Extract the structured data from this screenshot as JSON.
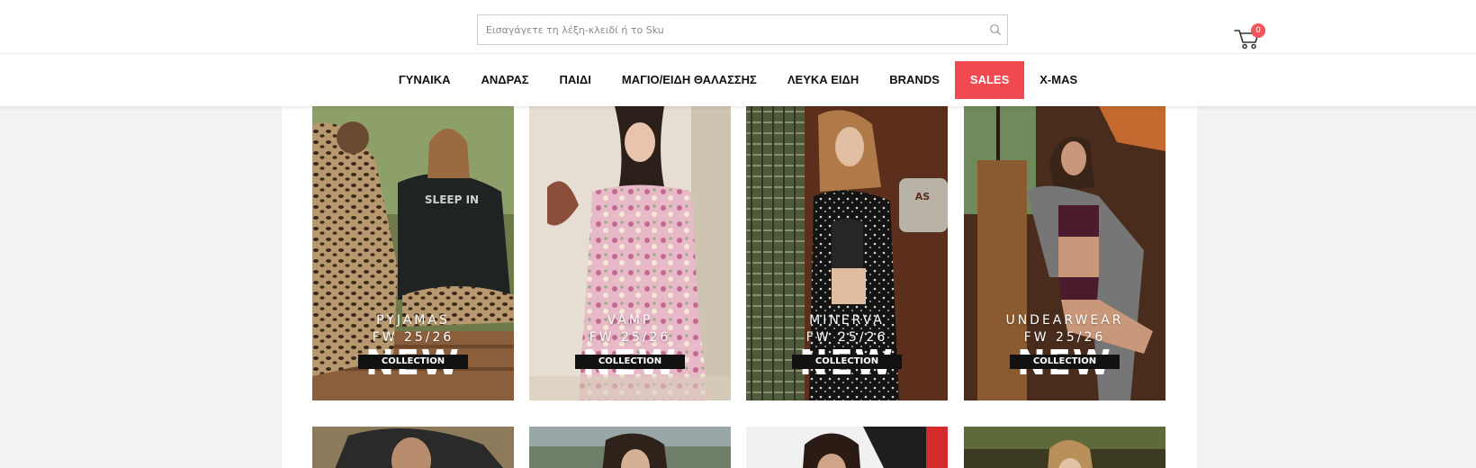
{
  "header": {
    "search": {
      "placeholder": "Εισαγάγετε τη λέξη-κλειδί ή το Sku",
      "value": ""
    },
    "cart": {
      "count": "0",
      "badge_color": "#f2545b"
    }
  },
  "nav": {
    "items": [
      {
        "label": "ΓΥΝΑΙΚΑ"
      },
      {
        "label": "ΑΝΔΡΑΣ"
      },
      {
        "label": "ΠΑΙΔΙ"
      },
      {
        "label": "ΜΑΓΙΟ/ΕΙΔΗ ΘΑΛΑΣΣΗΣ"
      },
      {
        "label": "ΛΕΥΚΑ ΕΙΔΗ"
      },
      {
        "label": "BRANDS"
      },
      {
        "label": "SALES",
        "highlight_color": "#f2484f"
      },
      {
        "label": "X-MAS"
      }
    ]
  },
  "collections": [
    {
      "line1": "PYJAMAS",
      "line2": "FW 25/26",
      "badge_new": "NEW",
      "badge_collection": "COLLECTION"
    },
    {
      "line1": "VAMP",
      "line2": "FW 25/26",
      "badge_new": "NEW",
      "badge_collection": "COLLECTION"
    },
    {
      "line1": "MINERVA",
      "line2": "FW 25/26",
      "badge_new": "NEW",
      "badge_collection": "COLLECTION"
    },
    {
      "line1": "UNDEARWEAR",
      "line2": "FW 25/26",
      "badge_new": "NEW",
      "badge_collection": "COLLECTION"
    }
  ]
}
